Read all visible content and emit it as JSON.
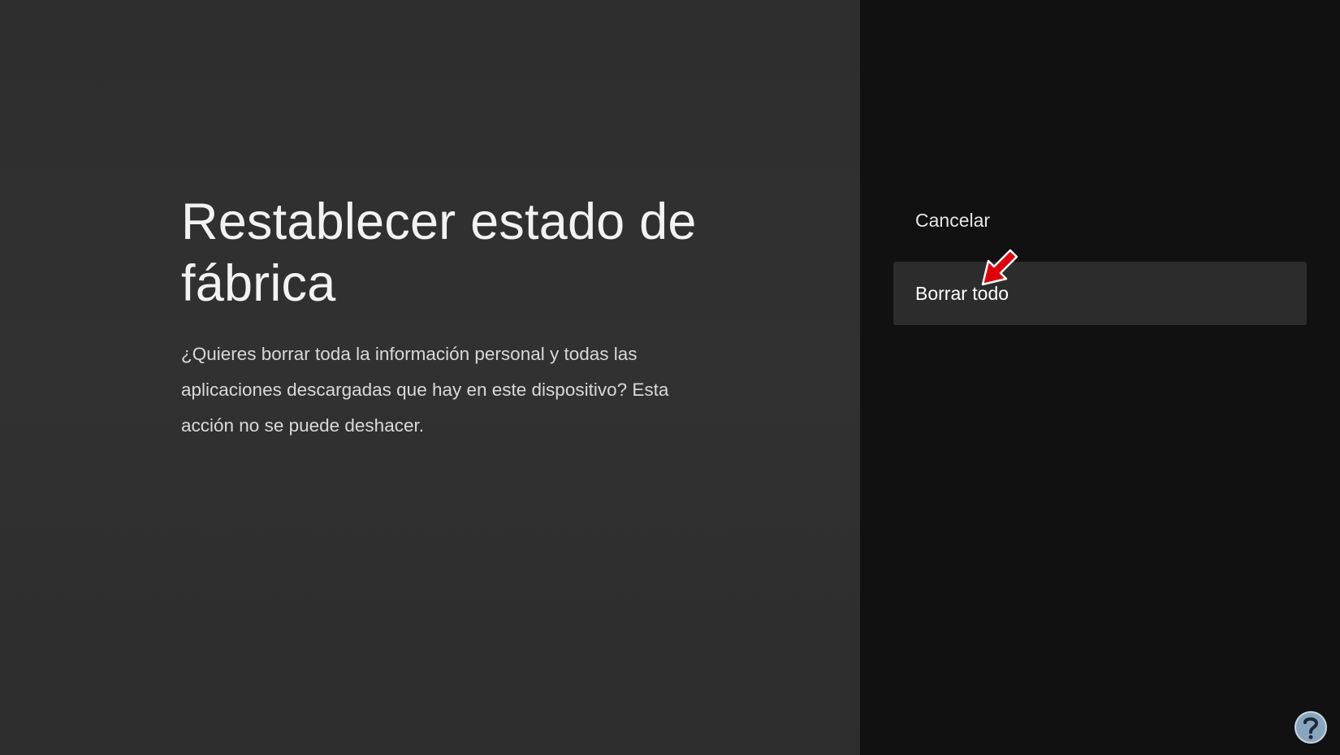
{
  "dialog": {
    "title": "Restablecer estado de fábrica",
    "description": "¿Quieres borrar toda la información personal y todas las aplicaciones descargadas que hay en este dispositivo? Esta acción no se puede deshacer."
  },
  "actions": {
    "cancel_label": "Cancelar",
    "erase_label": "Borrar todo"
  },
  "annotation": {
    "icon": "red-pointer-arrow-icon",
    "color": "#e0000b"
  },
  "watermark": {
    "icon": "help-question-logo-icon"
  },
  "colors": {
    "left_panel": "#2f2f2f",
    "right_panel": "#111111",
    "selected_item": "#2c2c2c",
    "text": "#ffffff"
  }
}
